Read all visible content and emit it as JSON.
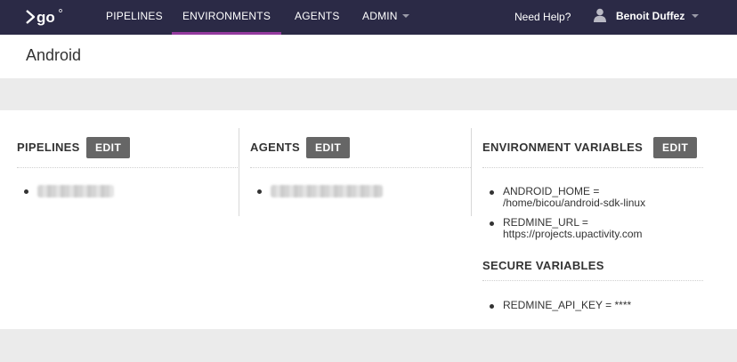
{
  "nav": {
    "logo_alt": "go",
    "items": [
      {
        "label": "PIPELINES"
      },
      {
        "label": "ENVIRONMENTS"
      },
      {
        "label": "AGENTS"
      },
      {
        "label": "ADMIN"
      }
    ],
    "active": "ENVIRONMENTS",
    "need_help": "Need Help?",
    "user_name": "Benoit Duffez",
    "accent_color": "#943a9e",
    "bar_color": "#2b2a46"
  },
  "page": {
    "title": "Android"
  },
  "sections": {
    "pipelines": {
      "title": "PIPELINES",
      "edit_label": "EDIT",
      "items": [
        "(blurred)"
      ]
    },
    "agents": {
      "title": "AGENTS",
      "edit_label": "EDIT",
      "items": [
        "(blurred)"
      ]
    },
    "env_vars": {
      "title": "ENVIRONMENT VARIABLES",
      "edit_label": "EDIT",
      "items": [
        {
          "line1": "ANDROID_HOME =",
          "line2": "/home/bicou/android-sdk-linux"
        },
        {
          "line1": "REDMINE_URL =",
          "line2": "https://projects.upactivity.com"
        }
      ]
    },
    "secure_vars": {
      "title": "SECURE VARIABLES",
      "items": [
        "REDMINE_API_KEY = ****"
      ]
    }
  },
  "icons": {
    "logo": "go-logo-icon",
    "user": "user-avatar-icon",
    "dropdown": "chevron-down-icon"
  }
}
